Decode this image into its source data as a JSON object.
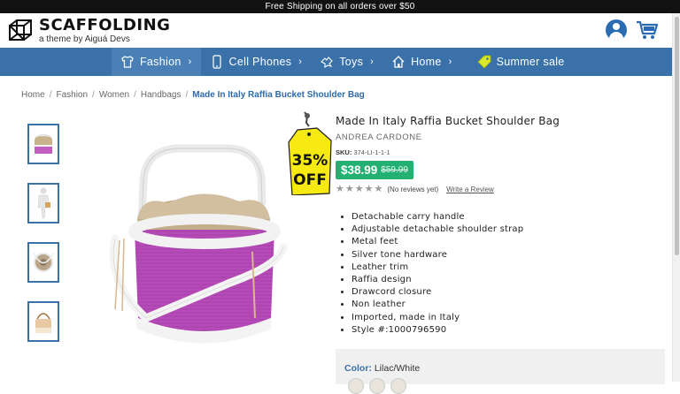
{
  "promo": "Free Shipping on all orders over $50",
  "logo": {
    "title": "SCAFFOLDING",
    "subtitle": "a theme by Aiguá Devs"
  },
  "header_icons": [
    "user-icon",
    "cart-icon"
  ],
  "nav": [
    {
      "label": "Fashion",
      "icon": "shirt-icon",
      "chevron": "›"
    },
    {
      "label": "Cell Phones",
      "icon": "phone-icon",
      "chevron": "›"
    },
    {
      "label": "Toys",
      "icon": "toy-icon",
      "chevron": "›"
    },
    {
      "label": "Home",
      "icon": "home-icon",
      "chevron": "›"
    },
    {
      "label": "Summer sale",
      "icon": "tag-icon"
    }
  ],
  "breadcrumb": [
    "Home",
    "Fashion",
    "Women",
    "Handbags",
    "Made In Italy Raffia Bucket Shoulder Bag"
  ],
  "tag": {
    "line1": "35%",
    "line2": "OFF"
  },
  "product": {
    "title": "Made In Italy Raffia Bucket Shoulder Bag",
    "brand": "ANDREA CARDONE",
    "sku_label": "SKU:",
    "sku": "374-LI-1-1-1",
    "price_now": "$38.99",
    "price_was": "$59.99",
    "rating_stars": 5,
    "reviews": "(No reviews yet)",
    "write_review": "Write a Review",
    "features": [
      "Detachable carry handle",
      "Adjustable detachable shoulder strap",
      "Metal feet",
      "Silver tone hardware",
      "Leather trim",
      "Raffia design",
      "Drawcord closure",
      "Non leather",
      "Imported, made in Italy",
      "Style #:1000796590"
    ]
  },
  "color": {
    "label": "Color:",
    "value": "Lilac/White"
  },
  "colors": {
    "accent": "#3a71a8",
    "price_bg": "#23b073",
    "tag_yellow": "#f5e400"
  }
}
